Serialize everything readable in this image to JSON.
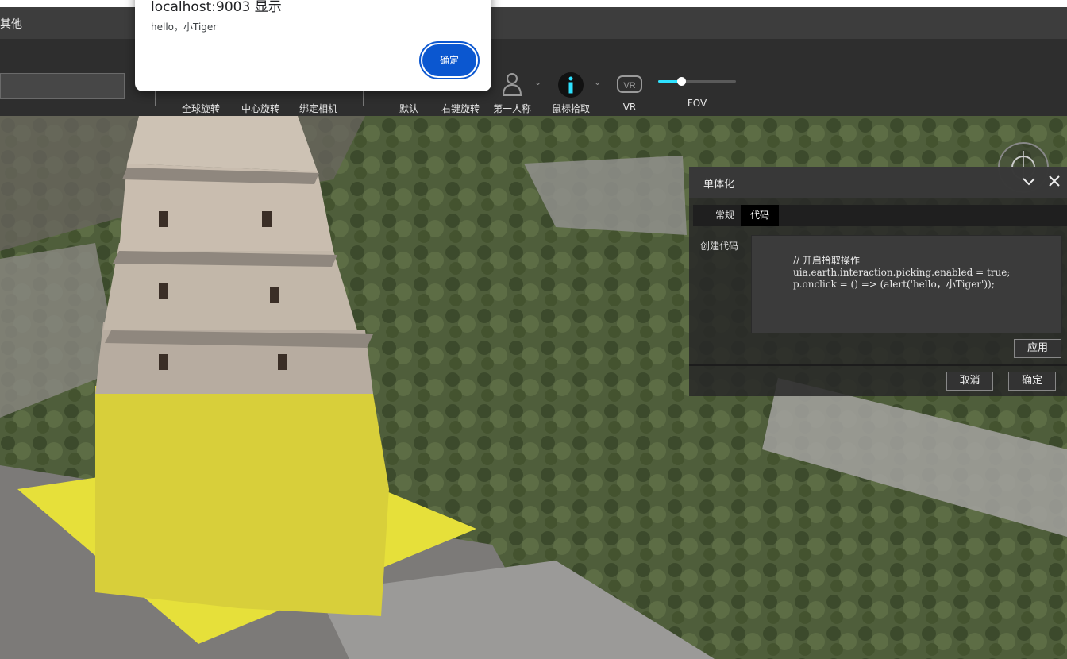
{
  "app": {
    "menu_other": "其他"
  },
  "toolbar": {
    "tools": [
      {
        "label": "全球旋转",
        "icon": "globe-rotate-icon"
      },
      {
        "label": "中心旋转",
        "icon": "center-rotate-icon"
      },
      {
        "label": "绑定相机",
        "icon": "bind-camera-icon"
      },
      {
        "label": "默认",
        "icon": "default-mode-icon"
      },
      {
        "label": "右键旋转",
        "icon": "right-click-rotate-icon"
      },
      {
        "label": "第一人称",
        "icon": "person-icon"
      },
      {
        "label": "鼠标拾取",
        "icon": "info-icon"
      },
      {
        "label": "VR",
        "icon": "vr-icon"
      }
    ],
    "fov": {
      "label": "FOV",
      "value": 0.3
    },
    "accent": "#2ee2ff"
  },
  "panel": {
    "title": "单体化",
    "tabs": [
      {
        "label": "常规",
        "active": false
      },
      {
        "label": "代码",
        "active": true
      }
    ],
    "code_label": "创建代码",
    "code_lines": [
      "// 开启拾取操作",
      "uia.earth.interaction.picking.enabled = true;",
      "p.onclick = () => (alert('hello，小Tiger'));"
    ],
    "apply_label": "应用",
    "cancel_label": "取消",
    "ok_label": "确定"
  },
  "dialog": {
    "title": "localhost:9003 显示",
    "message": "hello，小Tiger",
    "ok_label": "确定",
    "ok_color": "#0b57d0"
  },
  "scene": {
    "highlight_color": "#e6e03a"
  }
}
